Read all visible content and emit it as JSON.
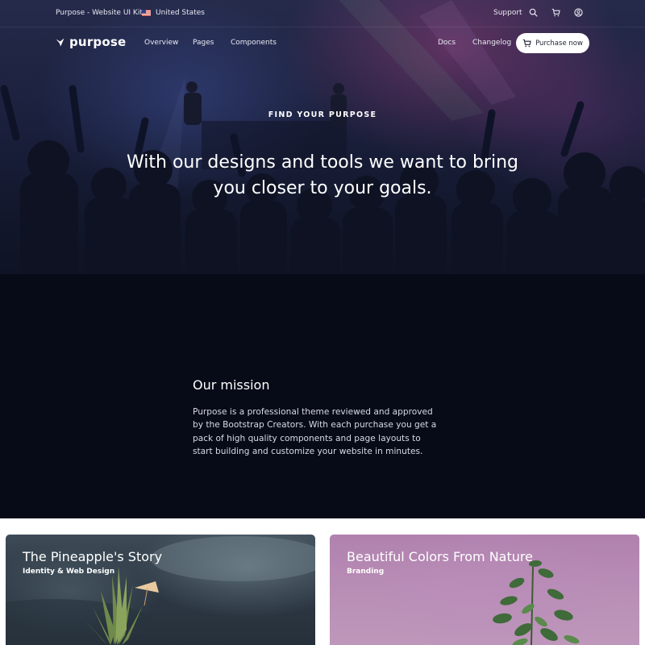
{
  "topbar": {
    "kit_label": "Purpose - Website UI Kit",
    "country": "United States",
    "support": "Support",
    "icons": [
      "us-flag-icon",
      "search-icon",
      "cart-icon",
      "user-circle-icon"
    ]
  },
  "nav": {
    "brand": "purpose",
    "links_left": [
      "Overview",
      "Pages",
      "Components"
    ],
    "links_right": [
      "Docs",
      "Changelog"
    ],
    "purchase": "Purchase now"
  },
  "hero": {
    "eyebrow": "FIND YOUR PURPOSE",
    "headline": "With our designs and tools we want to bring you closer to your goals."
  },
  "mission": {
    "title": "Our mission",
    "body": "Purpose is a professional theme reviewed and approved by the Bootstrap Creators. With each purchase you get a pack of high quality components and page layouts to start building and customize your website in minutes."
  },
  "cards": [
    {
      "title": "The Pineapple's Story",
      "subtitle": "Identity & Web Design"
    },
    {
      "title": "Beautiful Colors From Nature",
      "subtitle": "Branding"
    }
  ],
  "colors": {
    "hero_dark": "#1e2444",
    "mission_bg": "#060b17",
    "button_bg": "#ffffff",
    "card_purple": "#b98fb6",
    "card_slate": "#2d3844"
  }
}
